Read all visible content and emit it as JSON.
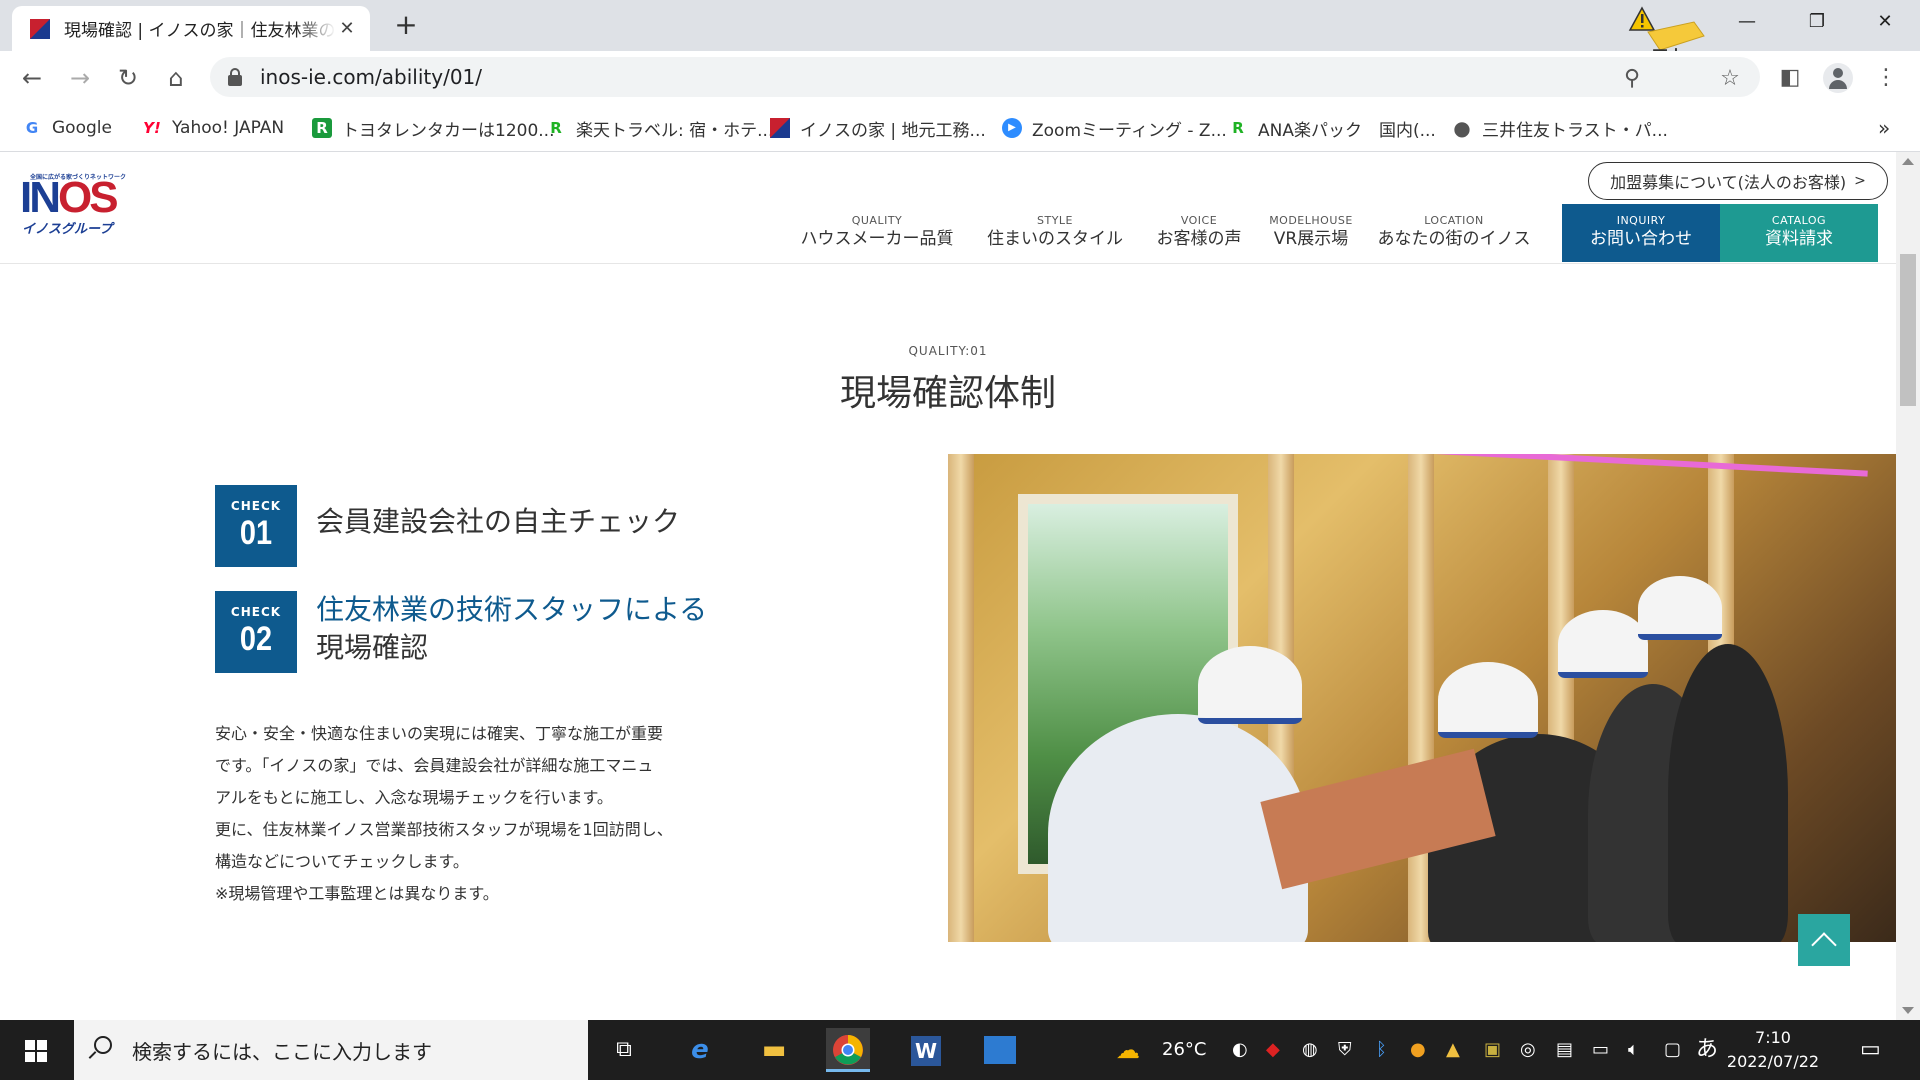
{
  "browser": {
    "tab": {
      "title": "現場確認 | イノスの家｜住友林業の",
      "close": "✕"
    },
    "new_tab": "+",
    "window": {
      "minimize": "—",
      "restore": "❐",
      "close": "✕"
    },
    "url": "inos-ie.com/ability/01/",
    "bookmarks": [
      {
        "label": "Google",
        "icon": "google-icon",
        "glyph": "G",
        "color": "#4285f4"
      },
      {
        "label": "Yahoo! JAPAN",
        "icon": "yahoo-icon",
        "glyph": "Y!",
        "color": "#ff0033"
      },
      {
        "label": "トヨタレンタカーは1200...",
        "icon": "toyota-rent-icon",
        "glyph": "R",
        "color": "#1a9a3c"
      },
      {
        "label": "楽天トラベル: 宿・ホテ...",
        "icon": "rakuten-icon",
        "glyph": "R",
        "color": "#1fb224"
      },
      {
        "label": "イノスの家 | 地元工務...",
        "icon": "inos-icon",
        "glyph": "",
        "color": "#c8202f"
      },
      {
        "label": "Zoomミーティング - Z...",
        "icon": "zoom-icon",
        "glyph": "▶",
        "color": "#2d8cff"
      },
      {
        "label": "ANA楽パック　国内(...",
        "icon": "rakuten-icon",
        "glyph": "R",
        "color": "#1fb224"
      },
      {
        "label": "三井住友トラスト・パ...",
        "icon": "globe-icon",
        "glyph": "●",
        "color": "#555555"
      }
    ],
    "bookmarks_overflow": "»"
  },
  "site": {
    "logo": {
      "tagline": "全国に広がる家づくりネットワーク",
      "main_a": "IN",
      "main_b": "OS",
      "sub": "イノスグループ"
    },
    "recruit_button": "加盟募集について(法人のお客様)",
    "nav": [
      {
        "en": "QUALITY",
        "jp": "ハウスメーカー品質"
      },
      {
        "en": "STYLE",
        "jp": "住まいのスタイル"
      },
      {
        "en": "VOICE",
        "jp": "お客様の声"
      },
      {
        "en": "MODELHOUSE",
        "jp": "VR展示場"
      },
      {
        "en": "LOCATION",
        "jp": "あなたの街のイノス"
      }
    ],
    "cta_inquiry": {
      "en": "INQUIRY",
      "jp": "お問い合わせ",
      "color": "#0e5a8e"
    },
    "cta_catalog": {
      "en": "CATALOG",
      "jp": "資料請求",
      "color": "#1e9a92"
    }
  },
  "content": {
    "kicker": "QUALITY:01",
    "title": "現場確認体制",
    "checks": [
      {
        "label": "CHECK",
        "num": "01",
        "line1": "会員建設会社の自主チェック",
        "line2": ""
      },
      {
        "label": "CHECK",
        "num": "02",
        "line1": "住友林業の技術スタッフによる",
        "line2": "現場確認"
      }
    ],
    "paragraphs": [
      "安心・安全・快適な住まいの実現には確実、丁寧な施工が重要\nです。「イノスの家」では、会員建設会社が詳細な施工マニュ\nアルをもとに施工し、入念な現場チェックを行います。",
      "更に、住友林業イノス営業部技術スタッフが現場を1回訪問し、\n構造などについてチェックします。",
      "※現場管理や工事監理とは異なります。"
    ]
  },
  "taskbar": {
    "search_placeholder": "検索するには、ここに入力します",
    "weather": "26°C",
    "ime": "あ",
    "time": "7:10",
    "date": "2022/07/22"
  }
}
